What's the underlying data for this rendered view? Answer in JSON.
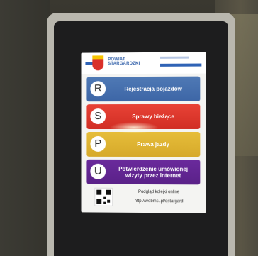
{
  "header": {
    "brand_line1": "POWIAT",
    "brand_line2": "STARGARDZKI"
  },
  "menu": [
    {
      "letter": "R",
      "label": "Rejestracja pojazdów",
      "color": "#4a74b2"
    },
    {
      "letter": "S",
      "label": "Sprawy bieżące",
      "color": "#e03a2f"
    },
    {
      "letter": "P",
      "label": "Prawa jazdy",
      "color": "#e0b634"
    },
    {
      "letter": "U",
      "label": "Potwierdzenie umówionej wizyty przez Internet",
      "color": "#632696"
    }
  ],
  "footer": {
    "title": "Podgląd kolejki online",
    "url": "http://webmsi.pl/qstargard"
  }
}
